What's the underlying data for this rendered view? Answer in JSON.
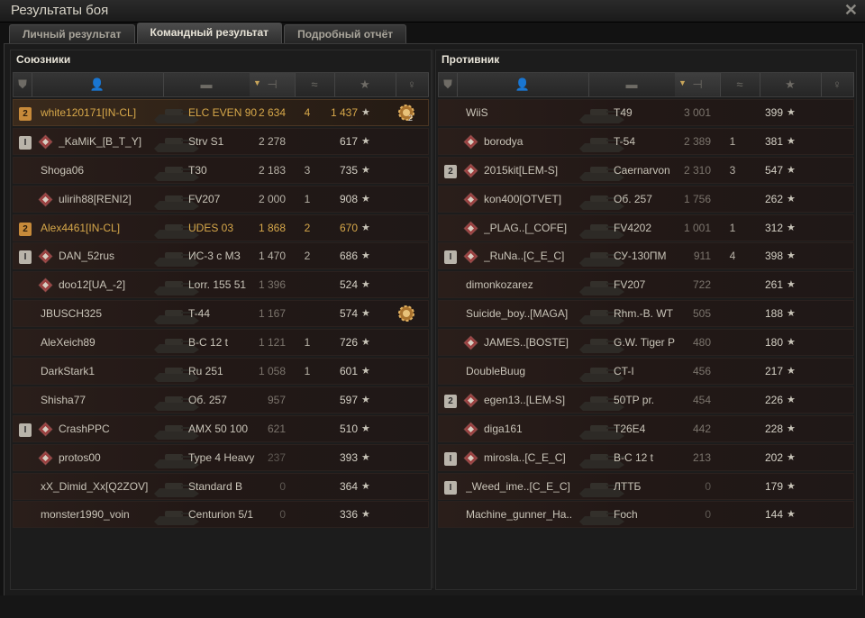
{
  "window": {
    "title": "Результаты боя",
    "close_icon": "close-icon"
  },
  "tabs": [
    {
      "label": "Личный результат",
      "active": false
    },
    {
      "label": "Командный результат",
      "active": true
    },
    {
      "label": "Подробный отчёт",
      "active": false
    }
  ],
  "allies": {
    "title": "Союзники",
    "rows": [
      {
        "player": "white120171[IN-CL]",
        "tank": "ELC EVEN 90",
        "damage": "2 634",
        "kills": "4",
        "xp": "1 437",
        "badge": "2",
        "badge_type": "gold",
        "medal": "2",
        "clan_icon": false,
        "style": "gold"
      },
      {
        "player": "_KaMiK_[B_T_Y]",
        "tank": "Strv S1",
        "damage": "2 278",
        "kills": "",
        "xp": "617",
        "badge": "I",
        "badge_type": "plat",
        "clan_icon": true,
        "style": ""
      },
      {
        "player": "Shoga06",
        "tank": "T30",
        "damage": "2 183",
        "kills": "3",
        "xp": "735",
        "badge": "",
        "clan_icon": false,
        "style": ""
      },
      {
        "player": "ulirih88[RENI2]",
        "tank": "FV207",
        "damage": "2 000",
        "kills": "1",
        "xp": "908",
        "badge": "",
        "clan_icon": true,
        "style": ""
      },
      {
        "player": "Alex4461[IN-CL]",
        "tank": "UDES 03",
        "damage": "1 868",
        "kills": "2",
        "xp": "670",
        "badge": "2",
        "badge_type": "gold",
        "clan_icon": false,
        "style": "gold"
      },
      {
        "player": "DAN_52rus",
        "tank": "ИС-3 с МЗ",
        "damage": "1 470",
        "kills": "2",
        "xp": "686",
        "badge": "I",
        "badge_type": "plat",
        "clan_icon": true,
        "style": ""
      },
      {
        "player": "doo12[UA_-2]",
        "tank": "Lorr. 155 51",
        "damage": "1 396",
        "kills": "",
        "xp": "524",
        "badge": "",
        "clan_icon": true,
        "style": "dim"
      },
      {
        "player": "JBUSCH325",
        "tank": "T-44",
        "damage": "1 167",
        "kills": "",
        "xp": "574",
        "badge": "",
        "medal": "",
        "clan_icon": false,
        "style": "dim"
      },
      {
        "player": "AleXeich89",
        "tank": "B-C 12 t",
        "damage": "1 121",
        "kills": "1",
        "xp": "726",
        "badge": "",
        "clan_icon": false,
        "style": "dim"
      },
      {
        "player": "DarkStark1",
        "tank": "Ru 251",
        "damage": "1 058",
        "kills": "1",
        "xp": "601",
        "badge": "",
        "clan_icon": false,
        "style": "dim"
      },
      {
        "player": "Shisha77",
        "tank": "Об. 257",
        "damage": "957",
        "kills": "",
        "xp": "597",
        "badge": "",
        "clan_icon": false,
        "style": "dim"
      },
      {
        "player": "CrashPPC",
        "tank": "AMX 50 100",
        "damage": "621",
        "kills": "",
        "xp": "510",
        "badge": "I",
        "badge_type": "plat",
        "clan_icon": true,
        "style": "dim"
      },
      {
        "player": "protos00",
        "tank": "Type 4 Heavy",
        "damage": "237",
        "kills": "",
        "xp": "393",
        "badge": "",
        "clan_icon": true,
        "style": "dim2"
      },
      {
        "player": "xX_Dimid_Xx[Q2ZOV]",
        "tank": "Standard B",
        "damage": "0",
        "kills": "",
        "xp": "364",
        "badge": "",
        "clan_icon": false,
        "style": "dim2"
      },
      {
        "player": "monster1990_voin",
        "tank": "Centurion 5/1",
        "damage": "0",
        "kills": "",
        "xp": "336",
        "badge": "",
        "clan_icon": false,
        "style": "dim2"
      }
    ]
  },
  "enemies": {
    "title": "Противник",
    "rows": [
      {
        "player": "WiiS",
        "tank": "T49",
        "damage": "3 001",
        "kills": "",
        "xp": "399",
        "badge": "",
        "clan_icon": false,
        "style": "dim"
      },
      {
        "player": "borodya",
        "tank": "T-54",
        "damage": "2 389",
        "kills": "1",
        "xp": "381",
        "badge": "",
        "clan_icon": true,
        "style": "dim"
      },
      {
        "player": "2015kit[LEM-S]",
        "tank": "Caernarvon",
        "damage": "2 310",
        "kills": "3",
        "xp": "547",
        "badge": "2",
        "badge_type": "plat",
        "clan_icon": true,
        "style": "dim"
      },
      {
        "player": "kon400[OTVET]",
        "tank": "Об. 257",
        "damage": "1 756",
        "kills": "",
        "xp": "262",
        "badge": "",
        "clan_icon": true,
        "style": "dim"
      },
      {
        "player": "_PLAG..[_COFE]",
        "tank": "FV4202",
        "damage": "1 001",
        "kills": "1",
        "xp": "312",
        "badge": "",
        "clan_icon": true,
        "style": "dim"
      },
      {
        "player": "_RuNa..[C_E_C]",
        "tank": "СУ-130ПМ",
        "damage": "911",
        "kills": "4",
        "xp": "398",
        "badge": "I",
        "badge_type": "plat",
        "clan_icon": true,
        "style": "dim"
      },
      {
        "player": "dimonkozarez",
        "tank": "FV207",
        "damage": "722",
        "kills": "",
        "xp": "261",
        "badge": "",
        "clan_icon": false,
        "style": "dim"
      },
      {
        "player": "Suicide_boy..[MAGA]",
        "tank": "Rhm.-B. WT",
        "damage": "505",
        "kills": "",
        "xp": "188",
        "badge": "",
        "clan_icon": false,
        "style": "dim"
      },
      {
        "player": "JAMES..[BOSTE]",
        "tank": "G.W. Tiger P",
        "damage": "480",
        "kills": "",
        "xp": "180",
        "badge": "",
        "clan_icon": true,
        "style": "dim"
      },
      {
        "player": "DoubleBuug",
        "tank": "CT-I",
        "damage": "456",
        "kills": "",
        "xp": "217",
        "badge": "",
        "clan_icon": false,
        "style": "dim"
      },
      {
        "player": "egen13..[LEM-S]",
        "tank": "50TP pr.",
        "damage": "454",
        "kills": "",
        "xp": "226",
        "badge": "2",
        "badge_type": "plat",
        "clan_icon": true,
        "style": "dim"
      },
      {
        "player": "diga161",
        "tank": "T26E4",
        "damage": "442",
        "kills": "",
        "xp": "228",
        "badge": "",
        "clan_icon": true,
        "style": "dim"
      },
      {
        "player": "mirosla..[C_E_C]",
        "tank": "B-C 12 t",
        "damage": "213",
        "kills": "",
        "xp": "202",
        "badge": "I",
        "badge_type": "plat",
        "clan_icon": true,
        "style": "dim"
      },
      {
        "player": "_Weed_ime..[C_E_C]",
        "tank": "ЛТТБ",
        "damage": "0",
        "kills": "",
        "xp": "179",
        "badge": "I",
        "badge_type": "plat",
        "clan_icon": false,
        "style": "dim2"
      },
      {
        "player": "Machine_gunner_Ha..",
        "tank": "Foch",
        "damage": "0",
        "kills": "",
        "xp": "144",
        "badge": "",
        "clan_icon": false,
        "style": "dim2"
      }
    ]
  },
  "columns": {
    "icons": [
      "platoon-icon",
      "player-icon",
      "tank-icon",
      "damage-icon",
      "kills-icon",
      "xp-star-icon",
      "medal-icon"
    ],
    "star_glyph": "★"
  },
  "colors": {
    "gold_text": "#d7a84a",
    "normal_text": "#c9c4b8",
    "dim_damage": "#7b746c"
  }
}
